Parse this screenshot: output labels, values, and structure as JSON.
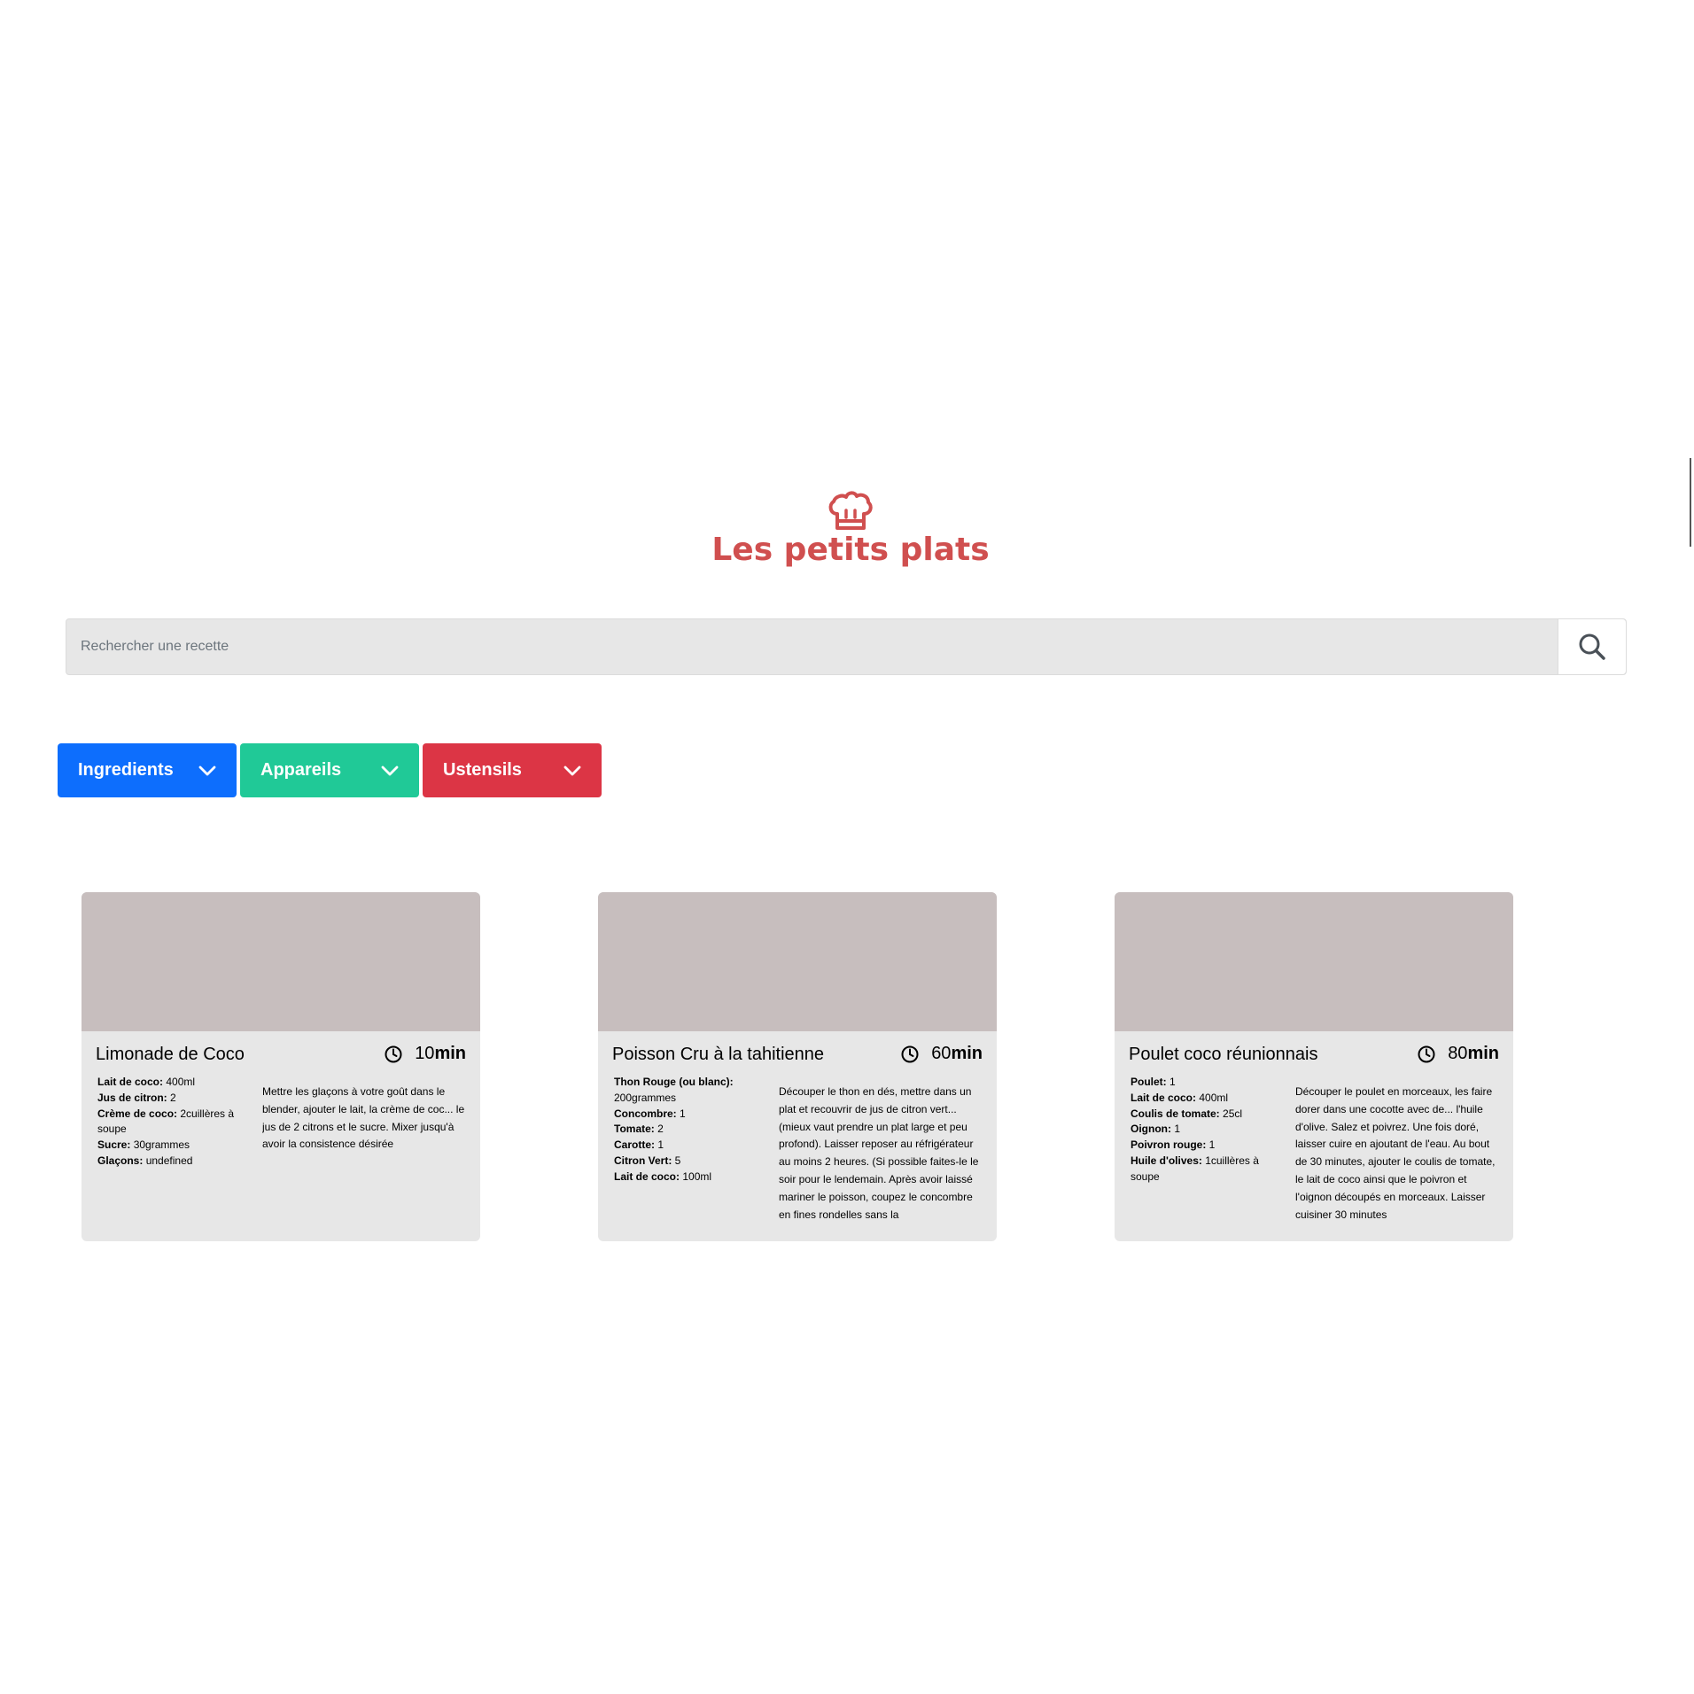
{
  "logo": {
    "icon": "chef-hat-icon",
    "text": "Les petits plats",
    "color": "#D04F4F"
  },
  "search": {
    "placeholder": "Rechercher une recette",
    "value": "",
    "button_icon": "search-icon"
  },
  "filters": [
    {
      "label": "Ingredients",
      "color": "#0D6EFD",
      "icon": "chevron-down-icon"
    },
    {
      "label": "Appareils",
      "color": "#20C997",
      "icon": "chevron-down-icon"
    },
    {
      "label": "Ustensils",
      "color": "#DC3545",
      "icon": "chevron-down-icon"
    }
  ],
  "recipes": [
    {
      "title": "Limonade de Coco",
      "time": "10",
      "time_unit": "min",
      "ingredients": [
        {
          "name": "Lait de coco:",
          "qty": " 400ml"
        },
        {
          "name": "Jus de citron:",
          "qty": " 2"
        },
        {
          "name": "Crème de coco:",
          "qty": " 2cuillères à soupe"
        },
        {
          "name": "Sucre:",
          "qty": " 30grammes"
        },
        {
          "name": "Glaçons:",
          "qty": " undefined"
        }
      ],
      "description": "Mettre les glaçons à votre goût dans le blender, ajouter le lait, la crème de coc... le jus de 2 citrons et le sucre. Mixer jusqu'à avoir la consistence désirée"
    },
    {
      "title": "Poisson Cru à la tahitienne",
      "time": "60",
      "time_unit": "min",
      "ingredients": [
        {
          "name": "Thon Rouge (ou blanc):",
          "qty": " 200grammes"
        },
        {
          "name": "Concombre:",
          "qty": " 1"
        },
        {
          "name": "Tomate:",
          "qty": " 2"
        },
        {
          "name": "Carotte:",
          "qty": " 1"
        },
        {
          "name": "Citron Vert:",
          "qty": " 5"
        },
        {
          "name": "Lait de coco:",
          "qty": " 100ml"
        }
      ],
      "description": "Découper le thon en dés, mettre dans un plat et recouvrir de jus de citron vert... (mieux vaut prendre un plat large et peu profond). Laisser reposer au réfrigérateur au moins 2 heures. (Si possible faites-le le soir pour le lendemain. Après avoir laissé mariner le poisson, coupez le concombre en fines rondelles sans la"
    },
    {
      "title": "Poulet coco réunionnais",
      "time": "80",
      "time_unit": "min",
      "ingredients": [
        {
          "name": "Poulet:",
          "qty": " 1"
        },
        {
          "name": "Lait de coco:",
          "qty": " 400ml"
        },
        {
          "name": "Coulis de tomate:",
          "qty": " 25cl"
        },
        {
          "name": "Oignon:",
          "qty": " 1"
        },
        {
          "name": "Poivron rouge:",
          "qty": " 1"
        },
        {
          "name": "Huile d'olives:",
          "qty": " 1cuillères à soupe"
        }
      ],
      "description": "Découper le poulet en morceaux, les faire dorer dans une cocotte avec de... l'huile d'olive. Salez et poivrez. Une fois doré, laisser cuire en ajoutant de l'eau. Au bout de 30 minutes, ajouter le coulis de tomate, le lait de coco ainsi que le poivron et l'oignon découpés en morceaux. Laisser cuisiner 30 minutes"
    }
  ]
}
